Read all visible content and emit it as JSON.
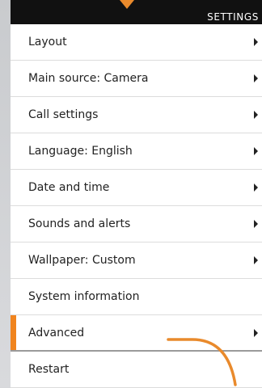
{
  "header": {
    "title": "SETTINGS"
  },
  "menu": {
    "items": [
      {
        "label": "Layout",
        "has_submenu": true
      },
      {
        "label": "Main source: Camera",
        "has_submenu": true
      },
      {
        "label": "Call settings",
        "has_submenu": true
      },
      {
        "label": "Language: English",
        "has_submenu": true
      },
      {
        "label": "Date and time",
        "has_submenu": true
      },
      {
        "label": "Sounds and alerts",
        "has_submenu": true
      },
      {
        "label": "Wallpaper: Custom",
        "has_submenu": true
      },
      {
        "label": "System information",
        "has_submenu": false
      },
      {
        "label": "Advanced",
        "has_submenu": true,
        "selected": true
      },
      {
        "label": "Restart",
        "has_submenu": false
      }
    ]
  },
  "colors": {
    "accent": "#f0841e",
    "header_bg": "#111111",
    "panel_bg": "#ffffff"
  },
  "icons": {
    "submenu": "chevron-right-icon"
  }
}
